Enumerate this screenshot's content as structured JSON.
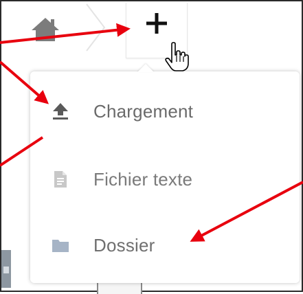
{
  "toolbar": {
    "home_icon": "home-icon",
    "separator_icon": "chevron-right-icon",
    "add_icon": "plus-icon"
  },
  "menu": {
    "items": [
      {
        "label": "Chargement",
        "icon": "upload-icon"
      },
      {
        "label": "Fichier texte",
        "icon": "text-file-icon"
      },
      {
        "label": "Dossier",
        "icon": "folder-icon"
      }
    ]
  },
  "colors": {
    "arrow": "#e8000e",
    "menu_text": "#6f6f6f",
    "folder_icon": "#a6b4c6",
    "file_icon": "#c8c8c8",
    "upload_icon": "#5a5a5a",
    "home_icon": "#7c7c7c"
  }
}
